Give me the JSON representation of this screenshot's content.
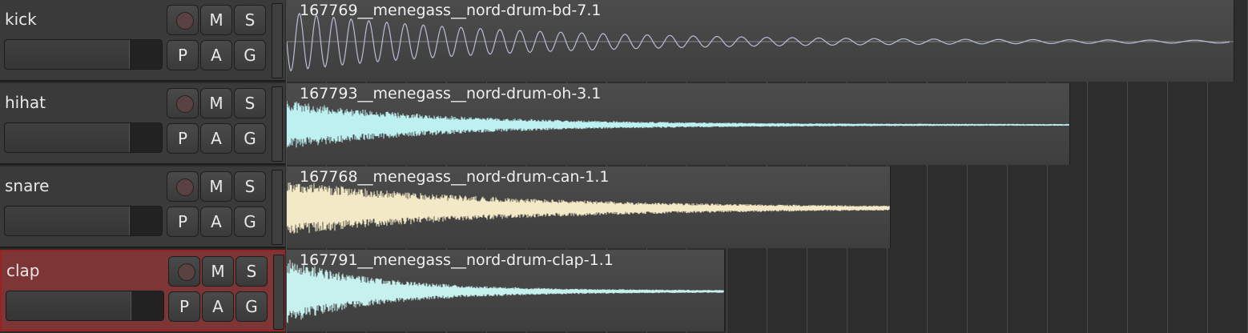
{
  "tracks": [
    {
      "name": "kick",
      "clip": "167769__menegass__nord-drum-bd-7.1",
      "wave_color": "#b8bfd6",
      "selected": false,
      "clip_fraction": 0.986,
      "decay": "kick"
    },
    {
      "name": "hihat",
      "clip": "167793__menegass__nord-drum-oh-3.1",
      "wave_color": "#bdf1f1",
      "selected": false,
      "clip_fraction": 0.815,
      "decay": "noise"
    },
    {
      "name": "snare",
      "clip": "167768__menegass__nord-drum-can-1.1",
      "wave_color": "#f4e9c6",
      "selected": false,
      "clip_fraction": 0.628,
      "decay": "snare"
    },
    {
      "name": "clap",
      "clip": "167791__menegass__nord-drum-clap-1.1",
      "wave_color": "#c7f1ee",
      "selected": true,
      "clip_fraction": 0.456,
      "decay": "clap"
    }
  ],
  "buttons": {
    "mute": "M",
    "solo": "S",
    "plugins": "P",
    "automation": "A",
    "group": "G"
  },
  "icons": {
    "record": "record-icon"
  },
  "colors": {
    "selected_header": "#7d3535",
    "lane_bg": "#2d2d2d",
    "clip_bg": "#474747"
  }
}
